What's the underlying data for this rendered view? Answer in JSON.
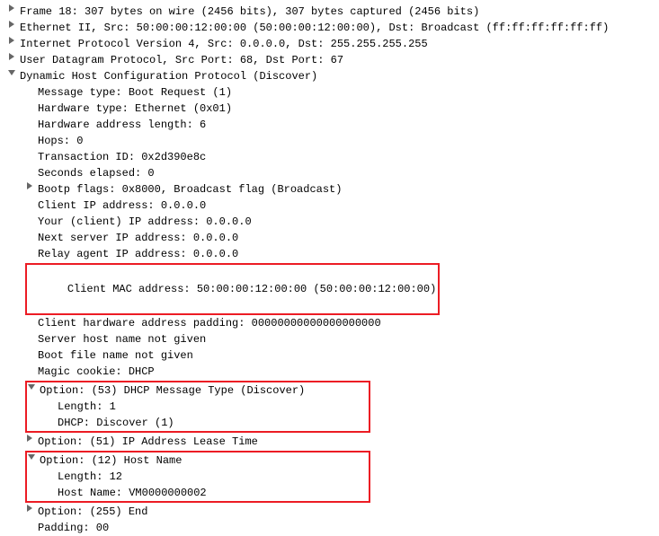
{
  "lines": {
    "frame": "Frame 18: 307 bytes on wire (2456 bits), 307 bytes captured (2456 bits)",
    "eth": "Ethernet II, Src: 50:00:00:12:00:00 (50:00:00:12:00:00), Dst: Broadcast (ff:ff:ff:ff:ff:ff)",
    "ip": "Internet Protocol Version 4, Src: 0.0.0.0, Dst: 255.255.255.255",
    "udp": "User Datagram Protocol, Src Port: 68, Dst Port: 67",
    "dhcp": "Dynamic Host Configuration Protocol (Discover)",
    "msgtype": "Message type: Boot Request (1)",
    "hwtype": "Hardware type: Ethernet (0x01)",
    "hwlen": "Hardware address length: 6",
    "hops": "Hops: 0",
    "xid": "Transaction ID: 0x2d390e8c",
    "secs": "Seconds elapsed: 0",
    "flags": "Bootp flags: 0x8000, Broadcast flag (Broadcast)",
    "ciaddr": "Client IP address: 0.0.0.0",
    "yiaddr": "Your (client) IP address: 0.0.0.0",
    "siaddr": "Next server IP address: 0.0.0.0",
    "giaddr": "Relay agent IP address: 0.0.0.0",
    "chaddr": "Client MAC address: 50:00:00:12:00:00 (50:00:00:12:00:00)",
    "chpad": "Client hardware address padding: 00000000000000000000",
    "sname": "Server host name not given",
    "bfile": "Boot file name not given",
    "cookie": "Magic cookie: DHCP",
    "opt53": "Option: (53) DHCP Message Type (Discover)",
    "opt53_len": "Length: 1",
    "opt53_val": "DHCP: Discover (1)",
    "opt51": "Option: (51) IP Address Lease Time",
    "opt12": "Option: (12) Host Name",
    "opt12_len": "Length: 12",
    "opt12_val": "Host Name: VM0000000002",
    "opt255": "Option: (255) End",
    "padding": "Padding: 00"
  }
}
